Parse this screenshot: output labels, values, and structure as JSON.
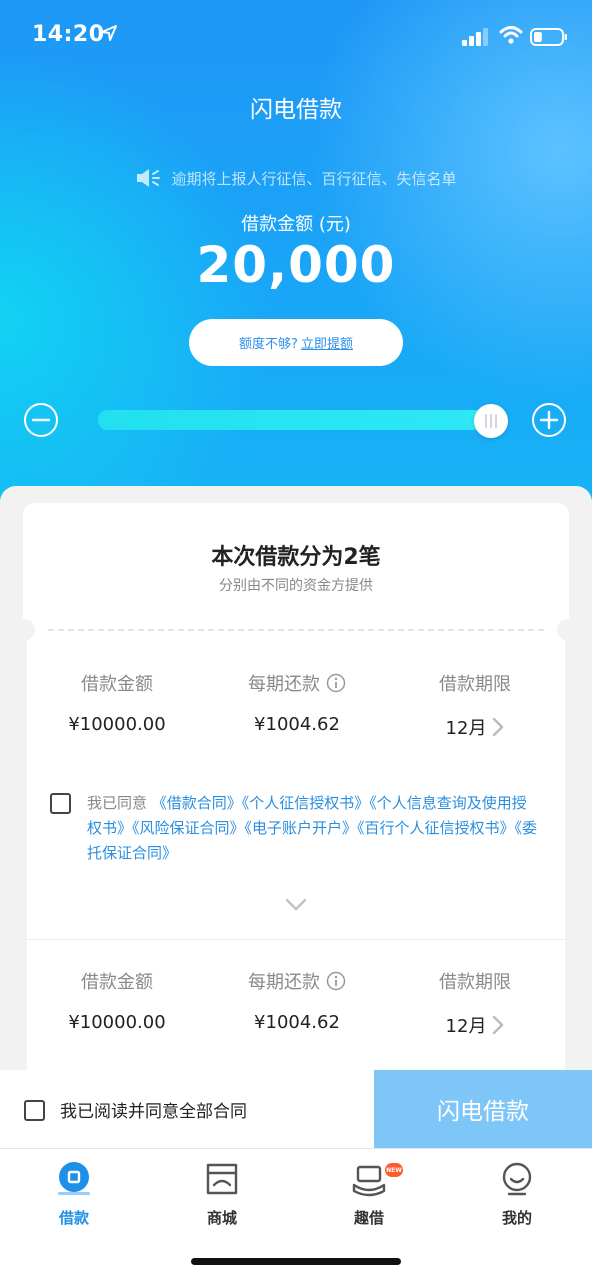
{
  "status": {
    "time": "14:20",
    "battery_level": 0.3
  },
  "header": {
    "title": "闪电借款"
  },
  "notice": {
    "text": "逾期将上报人行征信、百行征信、失信名单"
  },
  "amount": {
    "label": "借款金额 (元)",
    "value": "20,000"
  },
  "raise": {
    "prompt": "额度不够?",
    "link": "立即提额"
  },
  "slider": {
    "fill_percent": 96
  },
  "split": {
    "title": "本次借款分为2笔",
    "subtitle": "分别由不同的资金方提供"
  },
  "loans": [
    {
      "amount_label": "借款金额",
      "repay_label": "每期还款",
      "term_label": "借款期限",
      "amount": "¥10000.00",
      "repay": "¥1004.62",
      "term": "12月"
    },
    {
      "amount_label": "借款金额",
      "repay_label": "每期还款",
      "term_label": "借款期限",
      "amount": "¥10000.00",
      "repay": "¥1004.62",
      "term": "12月"
    }
  ],
  "agreement": {
    "prefix": "我已同意",
    "links": "《借款合同》《个人征信授权书》《个人信息查询及使用授权书》《风险保证合同》《电子账户开户》《百行个人征信授权书》《委托保证合同》"
  },
  "bottom": {
    "agree_all": "我已阅读并同意全部合同",
    "loan_button": "闪电借款"
  },
  "tabs": [
    {
      "label": "借款",
      "icon": "loan-icon",
      "active": true
    },
    {
      "label": "商城",
      "icon": "shop-icon",
      "active": false
    },
    {
      "label": "趣借",
      "icon": "fun-loan-icon",
      "active": false,
      "badge": "NEW"
    },
    {
      "label": "我的",
      "icon": "profile-icon",
      "active": false
    }
  ],
  "colors": {
    "primary": "#1e97f6",
    "accent": "#2a8fe0",
    "button_disabled": "#7fc6f8",
    "badge": "#ff5b2e"
  }
}
